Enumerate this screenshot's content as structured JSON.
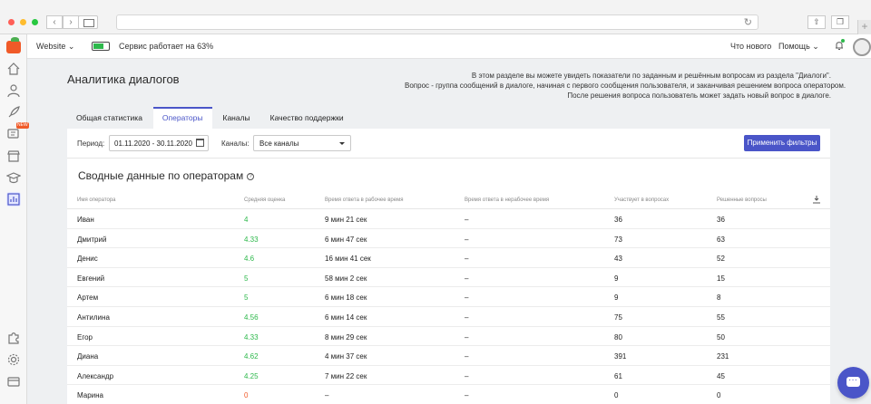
{
  "topbar": {
    "site": "Website",
    "status_text": "Сервис работает на 63%",
    "whats_new": "Что нового",
    "help": "Помощь"
  },
  "page": {
    "title": "Аналитика диалогов",
    "intro": [
      "В этом разделе вы можете увидеть показатели по заданным и решённым вопросам из раздела \"Диалоги\".",
      "Вопрос - группа сообщений в диалоге, начиная с первого сообщения пользователя, и заканчивая решением вопроса оператором.",
      "После решения вопроса пользователь может задать новый вопрос в диалоге."
    ]
  },
  "tabs": [
    "Общая статистика",
    "Операторы",
    "Каналы",
    "Качество поддержки"
  ],
  "filters": {
    "period_label": "Период:",
    "period_value": "01.11.2020 - 30.11.2020",
    "channels_label": "Каналы:",
    "channels_value": "Все каналы",
    "apply_label": "Применить фильтры"
  },
  "section": {
    "title": "Сводные данные по операторам",
    "help": "?"
  },
  "table": {
    "headers": [
      "Имя оператора",
      "Средняя оценка",
      "Время ответа в рабочее время",
      "Время ответа в нерабочее время",
      "Участвует в вопросах",
      "Решенные вопросы"
    ],
    "rows": [
      {
        "name": "Иван",
        "rating": "4",
        "rating_status": "good",
        "work_time": "9 мин 21 сек",
        "offhours": "–",
        "participates": "36",
        "resolved": "36"
      },
      {
        "name": "Дмитрий",
        "rating": "4.33",
        "rating_status": "good",
        "work_time": "6 мин 47 сек",
        "offhours": "–",
        "participates": "73",
        "resolved": "63"
      },
      {
        "name": "Денис",
        "rating": "4.6",
        "rating_status": "good",
        "work_time": "16 мин 41 сек",
        "offhours": "–",
        "participates": "43",
        "resolved": "52"
      },
      {
        "name": "Евгений",
        "rating": "5",
        "rating_status": "good",
        "work_time": "58 мин 2 сек",
        "offhours": "–",
        "participates": "9",
        "resolved": "15"
      },
      {
        "name": "Артем",
        "rating": "5",
        "rating_status": "good",
        "work_time": "6 мин 18 сек",
        "offhours": "–",
        "participates": "9",
        "resolved": "8"
      },
      {
        "name": "Антилина",
        "rating": "4.56",
        "rating_status": "good",
        "work_time": "6 мин 14 сек",
        "offhours": "–",
        "participates": "75",
        "resolved": "55"
      },
      {
        "name": "Егор",
        "rating": "4.33",
        "rating_status": "good",
        "work_time": "8 мин 29 сек",
        "offhours": "–",
        "participates": "80",
        "resolved": "50"
      },
      {
        "name": "Диана",
        "rating": "4.62",
        "rating_status": "good",
        "work_time": "4 мин 37 сек",
        "offhours": "–",
        "participates": "391",
        "resolved": "231"
      },
      {
        "name": "Александр",
        "rating": "4.25",
        "rating_status": "good",
        "work_time": "7 мин 22 сек",
        "offhours": "–",
        "participates": "61",
        "resolved": "45"
      },
      {
        "name": "Марина",
        "rating": "0",
        "rating_status": "bad",
        "work_time": "–",
        "offhours": "–",
        "participates": "0",
        "resolved": "0"
      }
    ]
  },
  "colors": {
    "accent": "#4a55c8",
    "good": "#2db84b",
    "bad": "#f05a28"
  }
}
